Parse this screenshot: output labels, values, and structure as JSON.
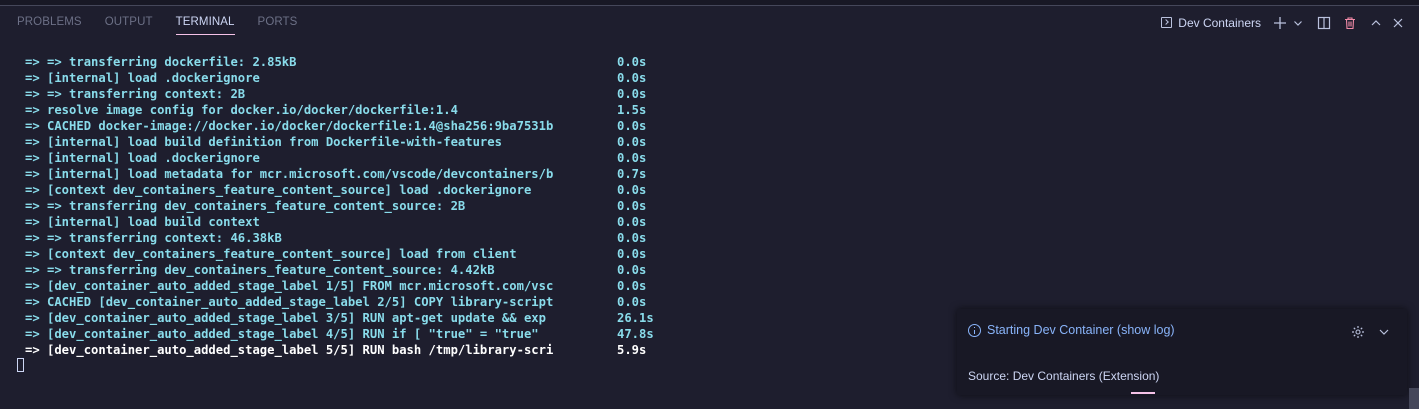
{
  "panel": {
    "tabs": [
      {
        "label": "PROBLEMS"
      },
      {
        "label": "OUTPUT"
      },
      {
        "label": "TERMINAL"
      },
      {
        "label": "PORTS"
      }
    ],
    "active_tab": "TERMINAL",
    "terminal_name": "Dev Containers"
  },
  "terminal": {
    "lines": [
      {
        "text": "=> => transferring dockerfile: 2.85kB",
        "duration": "0.0s"
      },
      {
        "text": "=> [internal] load .dockerignore",
        "duration": "0.0s"
      },
      {
        "text": "=> => transferring context: 2B",
        "duration": "0.0s"
      },
      {
        "text": "=> resolve image config for docker.io/docker/dockerfile:1.4",
        "duration": "1.5s"
      },
      {
        "text": "=> CACHED docker-image://docker.io/docker/dockerfile:1.4@sha256:9ba7531b",
        "duration": "0.0s"
      },
      {
        "text": "=> [internal] load build definition from Dockerfile-with-features",
        "duration": "0.0s"
      },
      {
        "text": "=> [internal] load .dockerignore",
        "duration": "0.0s"
      },
      {
        "text": "=> [internal] load metadata for mcr.microsoft.com/vscode/devcontainers/b",
        "duration": "0.7s"
      },
      {
        "text": "=> [context dev_containers_feature_content_source] load .dockerignore",
        "duration": "0.0s"
      },
      {
        "text": "=> => transferring dev_containers_feature_content_source: 2B",
        "duration": "0.0s"
      },
      {
        "text": "=> [internal] load build context",
        "duration": "0.0s"
      },
      {
        "text": "=> => transferring context: 46.38kB",
        "duration": "0.0s"
      },
      {
        "text": "=> [context dev_containers_feature_content_source] load from client",
        "duration": "0.0s"
      },
      {
        "text": "=> => transferring dev_containers_feature_content_source: 4.42kB",
        "duration": "0.0s"
      },
      {
        "text": "=> [dev_container_auto_added_stage_label 1/5] FROM mcr.microsoft.com/vsc",
        "duration": "0.0s"
      },
      {
        "text": "=> CACHED [dev_container_auto_added_stage_label 2/5] COPY library-script",
        "duration": "0.0s"
      },
      {
        "text": "=> [dev_container_auto_added_stage_label 3/5] RUN apt-get update && exp",
        "duration": "26.1s"
      },
      {
        "text": "=> [dev_container_auto_added_stage_label 4/5] RUN if [ \"true\" = \"true\"",
        "duration": "47.8s"
      },
      {
        "text": "=> [dev_container_auto_added_stage_label 5/5] RUN bash /tmp/library-scri",
        "duration": "5.9s"
      }
    ]
  },
  "notification": {
    "message": "Starting Dev Container (show log)",
    "source": "Source: Dev Containers (Extension)"
  },
  "colors": {
    "background": "#1e1e2e",
    "terminal_text": "#89dceb",
    "accent": "#f5c2e7",
    "info": "#89b4fa"
  }
}
